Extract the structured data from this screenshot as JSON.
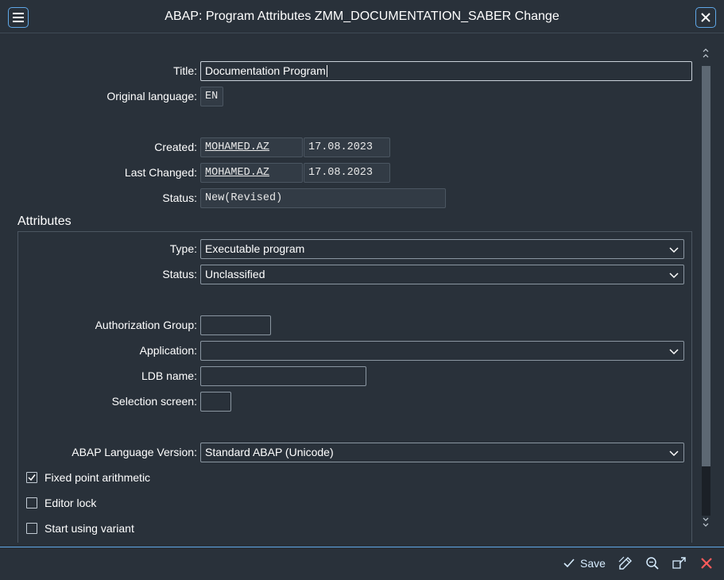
{
  "window": {
    "title": "ABAP: Program Attributes ZMM_DOCUMENTATION_SABER Change",
    "menu_icon": "hamburger-menu-icon",
    "close_icon": "close-icon"
  },
  "form": {
    "title_label": "Title:",
    "title_value": "Documentation Program",
    "orig_lang_label": "Original language:",
    "orig_lang_value": "EN",
    "created_label": "Created:",
    "created_user": "MOHAMED.AZ",
    "created_date": "17.08.2023",
    "changed_label": "Last Changed:",
    "changed_user": "MOHAMED.AZ",
    "changed_date": "17.08.2023",
    "status_label": "Status:",
    "status_value": "New(Revised)"
  },
  "attributes": {
    "section_title": "Attributes",
    "type_label": "Type:",
    "type_value": "Executable program",
    "status_label": "Status:",
    "status_value": "Unclassified",
    "auth_group_label": "Authorization Group:",
    "auth_group_value": "",
    "application_label": "Application:",
    "application_value": "",
    "ldb_label": "LDB name:",
    "ldb_value": "",
    "selection_screen_label": "Selection screen:",
    "selection_screen_value": "",
    "abap_version_label": "ABAP Language Version:",
    "abap_version_value": "Standard ABAP (Unicode)",
    "checkboxes": [
      {
        "label": "Fixed point arithmetic",
        "checked": true
      },
      {
        "label": "Editor lock",
        "checked": false
      },
      {
        "label": "Start using variant",
        "checked": false
      }
    ]
  },
  "footer": {
    "save_label": "Save",
    "icons": [
      "save-check-icon",
      "display-change-icon",
      "search-icon",
      "expand-icon",
      "cancel-icon"
    ]
  },
  "colors": {
    "background": "#29313a",
    "accent": "#5fa8e8",
    "cancel": "#ff5b5b"
  }
}
